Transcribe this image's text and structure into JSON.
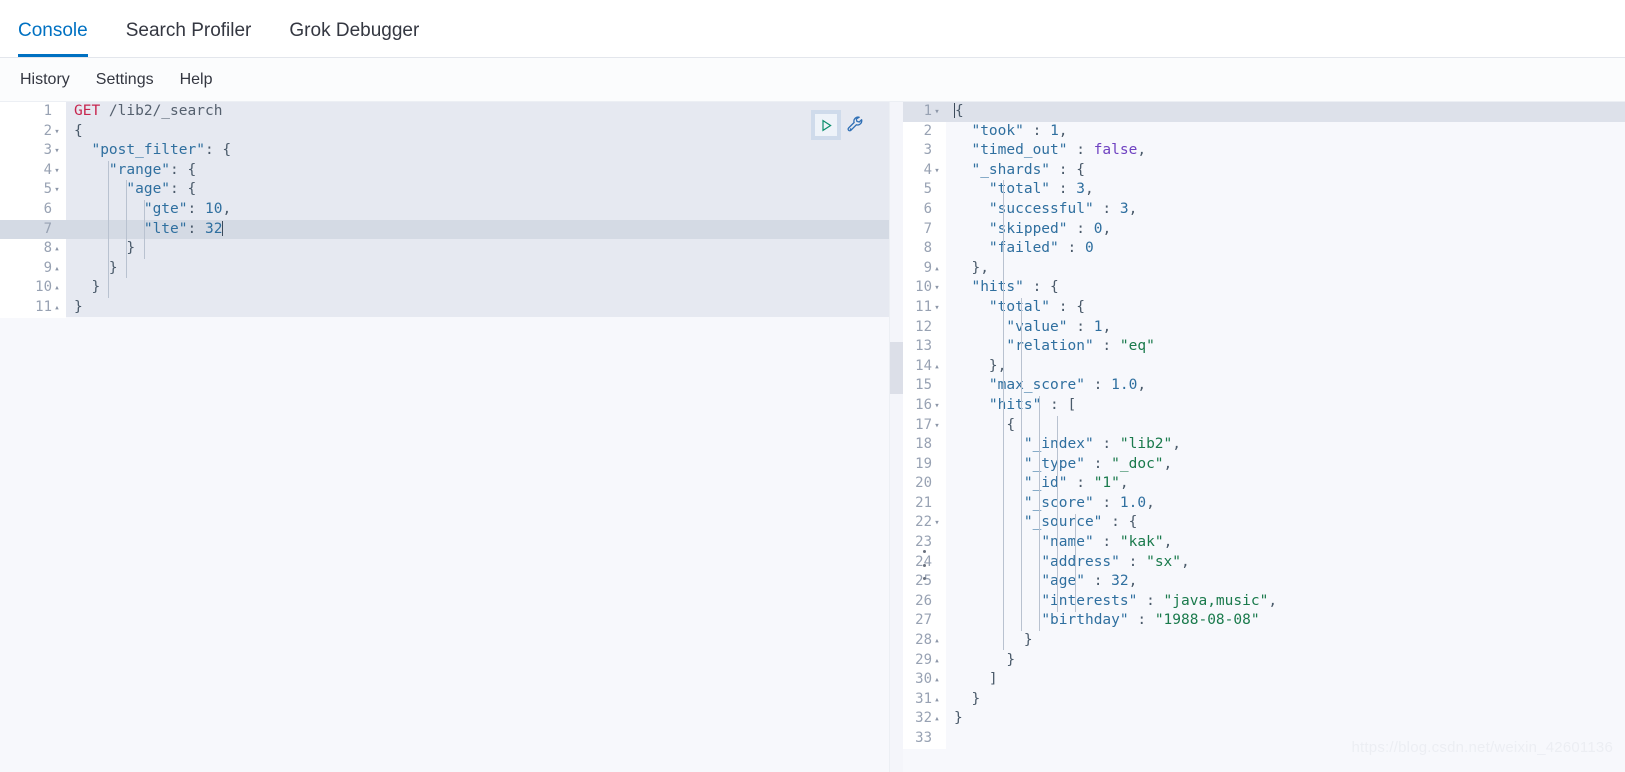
{
  "window": {
    "app": "Kibana Dev Tools Console",
    "watermark": "https://blog.csdn.net/weixin_42601136"
  },
  "tabs": [
    {
      "label": "Console",
      "active": true
    },
    {
      "label": "Search Profiler",
      "active": false
    },
    {
      "label": "Grok Debugger",
      "active": false
    }
  ],
  "menu": [
    {
      "label": "History"
    },
    {
      "label": "Settings"
    },
    {
      "label": "Help"
    }
  ],
  "actions": {
    "play_label": "Click to send request",
    "play_icon": "play-triangle-icon",
    "wrench_label": "Open documentation / options",
    "wrench_icon": "wrench-icon"
  },
  "colors": {
    "accent": "#0071c2",
    "method": "#c7254e",
    "key": "#2f6f9f",
    "string": "#1a7a4c",
    "boolean": "#6f42c1",
    "request_block_bg": "#e6e9f1",
    "active_line_bg": "#d4dae4",
    "editor_bg": "#f7f8fc"
  },
  "request_editor": {
    "name": "request-editor",
    "active_line": 7,
    "caret_line": 7,
    "lines": [
      {
        "n": 1,
        "fold": "",
        "tokens": [
          {
            "t": "method",
            "v": "GET"
          },
          {
            "t": "url",
            "v": " /lib2/_search"
          }
        ]
      },
      {
        "n": 2,
        "fold": "▾",
        "tokens": [
          {
            "t": "punc",
            "v": "{"
          }
        ]
      },
      {
        "n": 3,
        "fold": "▾",
        "tokens": [
          {
            "t": "punc",
            "v": "  "
          },
          {
            "t": "key",
            "v": "\"post_filter\""
          },
          {
            "t": "punc",
            "v": ": {"
          }
        ]
      },
      {
        "n": 4,
        "fold": "▾",
        "tokens": [
          {
            "t": "punc",
            "v": "    "
          },
          {
            "t": "key",
            "v": "\"range\""
          },
          {
            "t": "punc",
            "v": ": {"
          }
        ]
      },
      {
        "n": 5,
        "fold": "▾",
        "tokens": [
          {
            "t": "punc",
            "v": "      "
          },
          {
            "t": "key",
            "v": "\"age\""
          },
          {
            "t": "punc",
            "v": ": {"
          }
        ]
      },
      {
        "n": 6,
        "fold": "",
        "tokens": [
          {
            "t": "punc",
            "v": "        "
          },
          {
            "t": "key",
            "v": "\"gte\""
          },
          {
            "t": "punc",
            "v": ": "
          },
          {
            "t": "num",
            "v": "10"
          },
          {
            "t": "punc",
            "v": ","
          }
        ]
      },
      {
        "n": 7,
        "fold": "",
        "tokens": [
          {
            "t": "punc",
            "v": "        "
          },
          {
            "t": "key",
            "v": "\"lte\""
          },
          {
            "t": "punc",
            "v": ": "
          },
          {
            "t": "num",
            "v": "32"
          },
          {
            "t": "caret",
            "v": ""
          }
        ]
      },
      {
        "n": 8,
        "fold": "▴",
        "tokens": [
          {
            "t": "punc",
            "v": "      }"
          }
        ]
      },
      {
        "n": 9,
        "fold": "▴",
        "tokens": [
          {
            "t": "punc",
            "v": "    }"
          }
        ]
      },
      {
        "n": 10,
        "fold": "▴",
        "tokens": [
          {
            "t": "punc",
            "v": "  }"
          }
        ]
      },
      {
        "n": 11,
        "fold": "▴",
        "tokens": [
          {
            "t": "punc",
            "v": "}"
          }
        ]
      }
    ]
  },
  "response_editor": {
    "name": "response-viewer",
    "active_line": 1,
    "lines": [
      {
        "n": 1,
        "fold": "▾",
        "tokens": [
          {
            "t": "caret",
            "v": ""
          },
          {
            "t": "punc",
            "v": "{"
          }
        ]
      },
      {
        "n": 2,
        "fold": "",
        "tokens": [
          {
            "t": "punc",
            "v": "  "
          },
          {
            "t": "key",
            "v": "\"took\""
          },
          {
            "t": "punc",
            "v": " : "
          },
          {
            "t": "num",
            "v": "1"
          },
          {
            "t": "punc",
            "v": ","
          }
        ]
      },
      {
        "n": 3,
        "fold": "",
        "tokens": [
          {
            "t": "punc",
            "v": "  "
          },
          {
            "t": "key",
            "v": "\"timed_out\""
          },
          {
            "t": "punc",
            "v": " : "
          },
          {
            "t": "bool",
            "v": "false"
          },
          {
            "t": "punc",
            "v": ","
          }
        ]
      },
      {
        "n": 4,
        "fold": "▾",
        "tokens": [
          {
            "t": "punc",
            "v": "  "
          },
          {
            "t": "key",
            "v": "\"_shards\""
          },
          {
            "t": "punc",
            "v": " : {"
          }
        ]
      },
      {
        "n": 5,
        "fold": "",
        "tokens": [
          {
            "t": "punc",
            "v": "    "
          },
          {
            "t": "key",
            "v": "\"total\""
          },
          {
            "t": "punc",
            "v": " : "
          },
          {
            "t": "num",
            "v": "3"
          },
          {
            "t": "punc",
            "v": ","
          }
        ]
      },
      {
        "n": 6,
        "fold": "",
        "tokens": [
          {
            "t": "punc",
            "v": "    "
          },
          {
            "t": "key",
            "v": "\"successful\""
          },
          {
            "t": "punc",
            "v": " : "
          },
          {
            "t": "num",
            "v": "3"
          },
          {
            "t": "punc",
            "v": ","
          }
        ]
      },
      {
        "n": 7,
        "fold": "",
        "tokens": [
          {
            "t": "punc",
            "v": "    "
          },
          {
            "t": "key",
            "v": "\"skipped\""
          },
          {
            "t": "punc",
            "v": " : "
          },
          {
            "t": "num",
            "v": "0"
          },
          {
            "t": "punc",
            "v": ","
          }
        ]
      },
      {
        "n": 8,
        "fold": "",
        "tokens": [
          {
            "t": "punc",
            "v": "    "
          },
          {
            "t": "key",
            "v": "\"failed\""
          },
          {
            "t": "punc",
            "v": " : "
          },
          {
            "t": "num",
            "v": "0"
          }
        ]
      },
      {
        "n": 9,
        "fold": "▴",
        "tokens": [
          {
            "t": "punc",
            "v": "  },"
          }
        ]
      },
      {
        "n": 10,
        "fold": "▾",
        "tokens": [
          {
            "t": "punc",
            "v": "  "
          },
          {
            "t": "key",
            "v": "\"hits\""
          },
          {
            "t": "punc",
            "v": " : {"
          }
        ]
      },
      {
        "n": 11,
        "fold": "▾",
        "tokens": [
          {
            "t": "punc",
            "v": "    "
          },
          {
            "t": "key",
            "v": "\"total\""
          },
          {
            "t": "punc",
            "v": " : {"
          }
        ]
      },
      {
        "n": 12,
        "fold": "",
        "tokens": [
          {
            "t": "punc",
            "v": "      "
          },
          {
            "t": "key",
            "v": "\"value\""
          },
          {
            "t": "punc",
            "v": " : "
          },
          {
            "t": "num",
            "v": "1"
          },
          {
            "t": "punc",
            "v": ","
          }
        ]
      },
      {
        "n": 13,
        "fold": "",
        "tokens": [
          {
            "t": "punc",
            "v": "      "
          },
          {
            "t": "key",
            "v": "\"relation\""
          },
          {
            "t": "punc",
            "v": " : "
          },
          {
            "t": "str",
            "v": "\"eq\""
          }
        ]
      },
      {
        "n": 14,
        "fold": "▴",
        "tokens": [
          {
            "t": "punc",
            "v": "    },"
          }
        ]
      },
      {
        "n": 15,
        "fold": "",
        "tokens": [
          {
            "t": "punc",
            "v": "    "
          },
          {
            "t": "key",
            "v": "\"max_score\""
          },
          {
            "t": "punc",
            "v": " : "
          },
          {
            "t": "num",
            "v": "1.0"
          },
          {
            "t": "punc",
            "v": ","
          }
        ]
      },
      {
        "n": 16,
        "fold": "▾",
        "tokens": [
          {
            "t": "punc",
            "v": "    "
          },
          {
            "t": "key",
            "v": "\"hits\""
          },
          {
            "t": "punc",
            "v": " : ["
          }
        ]
      },
      {
        "n": 17,
        "fold": "▾",
        "tokens": [
          {
            "t": "punc",
            "v": "      {"
          }
        ]
      },
      {
        "n": 18,
        "fold": "",
        "tokens": [
          {
            "t": "punc",
            "v": "        "
          },
          {
            "t": "key",
            "v": "\"_index\""
          },
          {
            "t": "punc",
            "v": " : "
          },
          {
            "t": "str",
            "v": "\"lib2\""
          },
          {
            "t": "punc",
            "v": ","
          }
        ]
      },
      {
        "n": 19,
        "fold": "",
        "tokens": [
          {
            "t": "punc",
            "v": "        "
          },
          {
            "t": "key",
            "v": "\"_type\""
          },
          {
            "t": "punc",
            "v": " : "
          },
          {
            "t": "str",
            "v": "\"_doc\""
          },
          {
            "t": "punc",
            "v": ","
          }
        ]
      },
      {
        "n": 20,
        "fold": "",
        "tokens": [
          {
            "t": "punc",
            "v": "        "
          },
          {
            "t": "key",
            "v": "\"_id\""
          },
          {
            "t": "punc",
            "v": " : "
          },
          {
            "t": "str",
            "v": "\"1\""
          },
          {
            "t": "punc",
            "v": ","
          }
        ]
      },
      {
        "n": 21,
        "fold": "",
        "tokens": [
          {
            "t": "punc",
            "v": "        "
          },
          {
            "t": "key",
            "v": "\"_score\""
          },
          {
            "t": "punc",
            "v": " : "
          },
          {
            "t": "num",
            "v": "1.0"
          },
          {
            "t": "punc",
            "v": ","
          }
        ]
      },
      {
        "n": 22,
        "fold": "▾",
        "tokens": [
          {
            "t": "punc",
            "v": "        "
          },
          {
            "t": "key",
            "v": "\"_source\""
          },
          {
            "t": "punc",
            "v": " : {"
          }
        ]
      },
      {
        "n": 23,
        "fold": "",
        "tokens": [
          {
            "t": "punc",
            "v": "          "
          },
          {
            "t": "key",
            "v": "\"name\""
          },
          {
            "t": "punc",
            "v": " : "
          },
          {
            "t": "str",
            "v": "\"kak\""
          },
          {
            "t": "punc",
            "v": ","
          }
        ]
      },
      {
        "n": 24,
        "fold": "",
        "tokens": [
          {
            "t": "punc",
            "v": "          "
          },
          {
            "t": "key",
            "v": "\"address\""
          },
          {
            "t": "punc",
            "v": " : "
          },
          {
            "t": "str",
            "v": "\"sx\""
          },
          {
            "t": "punc",
            "v": ","
          }
        ]
      },
      {
        "n": 25,
        "fold": "",
        "tokens": [
          {
            "t": "punc",
            "v": "          "
          },
          {
            "t": "key",
            "v": "\"age\""
          },
          {
            "t": "punc",
            "v": " : "
          },
          {
            "t": "num",
            "v": "32"
          },
          {
            "t": "punc",
            "v": ","
          }
        ]
      },
      {
        "n": 26,
        "fold": "",
        "tokens": [
          {
            "t": "punc",
            "v": "          "
          },
          {
            "t": "key",
            "v": "\"interests\""
          },
          {
            "t": "punc",
            "v": " : "
          },
          {
            "t": "str",
            "v": "\"java,music\""
          },
          {
            "t": "punc",
            "v": ","
          }
        ]
      },
      {
        "n": 27,
        "fold": "",
        "tokens": [
          {
            "t": "punc",
            "v": "          "
          },
          {
            "t": "key",
            "v": "\"birthday\""
          },
          {
            "t": "punc",
            "v": " : "
          },
          {
            "t": "str",
            "v": "\"1988-08-08\""
          }
        ]
      },
      {
        "n": 28,
        "fold": "▴",
        "tokens": [
          {
            "t": "punc",
            "v": "        }"
          }
        ]
      },
      {
        "n": 29,
        "fold": "▴",
        "tokens": [
          {
            "t": "punc",
            "v": "      }"
          }
        ]
      },
      {
        "n": 30,
        "fold": "▴",
        "tokens": [
          {
            "t": "punc",
            "v": "    ]"
          }
        ]
      },
      {
        "n": 31,
        "fold": "▴",
        "tokens": [
          {
            "t": "punc",
            "v": "  }"
          }
        ]
      },
      {
        "n": 32,
        "fold": "▴",
        "tokens": [
          {
            "t": "punc",
            "v": "}"
          }
        ]
      },
      {
        "n": 33,
        "fold": "",
        "tokens": []
      }
    ]
  },
  "response_payload": {
    "took": 1,
    "timed_out": false,
    "_shards": {
      "total": 3,
      "successful": 3,
      "skipped": 0,
      "failed": 0
    },
    "hits": {
      "total": {
        "value": 1,
        "relation": "eq"
      },
      "max_score": 1.0,
      "hits": [
        {
          "_index": "lib2",
          "_type": "_doc",
          "_id": "1",
          "_score": 1.0,
          "_source": {
            "name": "kak",
            "address": "sx",
            "age": 32,
            "interests": "java,music",
            "birthday": "1988-08-08"
          }
        }
      ]
    }
  },
  "request_payload": {
    "method": "GET",
    "path": "/lib2/_search",
    "body": {
      "post_filter": {
        "range": {
          "age": {
            "gte": 10,
            "lte": 32
          }
        }
      }
    }
  }
}
